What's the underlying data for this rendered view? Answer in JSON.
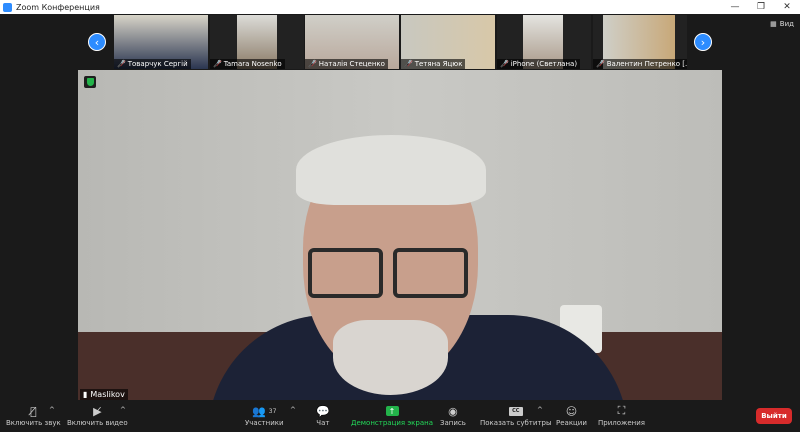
{
  "window": {
    "title": "Zoom Конференция",
    "minimize": "—",
    "restore": "❐",
    "close": "✕"
  },
  "gallery": {
    "view_label": "Вид",
    "participants": [
      {
        "name": "Товарчук Сергій",
        "muted": true
      },
      {
        "name": "Tamara Nosenko",
        "muted": true
      },
      {
        "name": "Наталія Стеценко",
        "muted": true
      },
      {
        "name": "Тетяна Яцюк",
        "muted": true
      },
      {
        "name": "iPhone (Светлана)",
        "muted": true
      },
      {
        "name": "Валентин Петренко [...",
        "muted": true
      }
    ]
  },
  "main_video": {
    "speaker": "Maslikov"
  },
  "toolbar": {
    "unmute": "Включить звук",
    "start_video": "Включить видео",
    "participants": "Участники",
    "participants_count": "37",
    "chat": "Чат",
    "share": "Демонстрация экрана",
    "record": "Запись",
    "captions": "Показать субтитры",
    "captions_icon": "CC",
    "reactions": "Реакции",
    "apps": "Приложения",
    "leave": "Выйти"
  },
  "colors": {
    "accent": "#2d8cff",
    "share": "#23d959",
    "leave": "#d72b2b"
  }
}
